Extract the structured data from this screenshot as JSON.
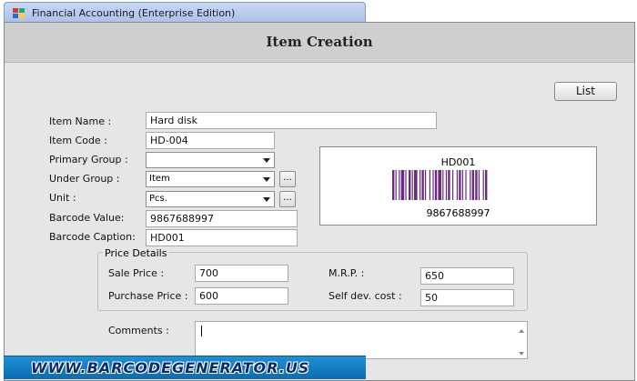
{
  "app": {
    "title": "Financial Accounting (Enterprise Edition)",
    "icon": "app-icon"
  },
  "header": {
    "title": "Item Creation"
  },
  "buttons": {
    "list_label": "List",
    "browse_label": "..."
  },
  "form": {
    "item_name": {
      "label": "Item Name :",
      "value": "Hard disk"
    },
    "item_code": {
      "label": "Item Code :",
      "value": "HD-004"
    },
    "primary_group": {
      "label": "Primary Group :",
      "value": ""
    },
    "under_group": {
      "label": "Under Group :",
      "value": "Item"
    },
    "unit": {
      "label": "Unit :",
      "value": "Pcs."
    },
    "barcode_value": {
      "label": "Barcode Value:",
      "value": "9867688997"
    },
    "barcode_caption": {
      "label": "Barcode Caption:",
      "value": "HD001"
    }
  },
  "barcode_preview": {
    "caption": "HD001",
    "value": "9867688997",
    "bar_color": "#6a2b82"
  },
  "price_details": {
    "legend": "Price Details",
    "sale_price": {
      "label": "Sale Price :",
      "value": "700"
    },
    "purchase_price": {
      "label": "Purchase Price :",
      "value": "600"
    },
    "mrp": {
      "label": "M.R.P. :",
      "value": "650"
    },
    "self_dev_cost": {
      "label": "Self dev. cost :",
      "value": "50"
    }
  },
  "comments": {
    "label": "Comments :",
    "value": ""
  },
  "banner": {
    "text": "WWW.BARCODEGENERATOR.US"
  }
}
